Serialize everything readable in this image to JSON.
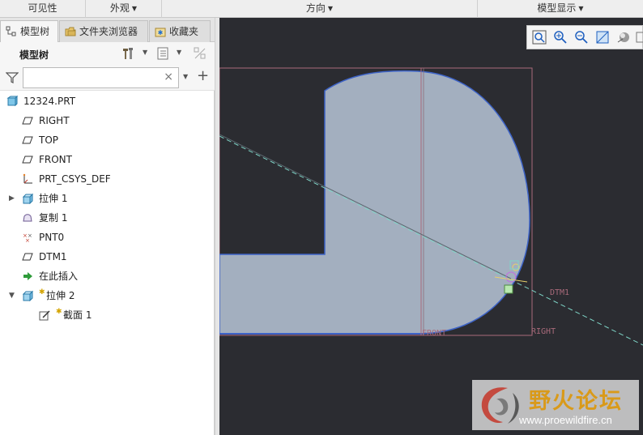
{
  "ribbon": {
    "groups": [
      {
        "label": "可见性",
        "dropdown": false
      },
      {
        "label": "外观",
        "dropdown": true
      },
      {
        "label": "方向",
        "dropdown": true
      },
      {
        "label": "模型显示",
        "dropdown": true
      }
    ]
  },
  "tabs": [
    {
      "label": "模型树",
      "icon": "tree-icon",
      "active": true
    },
    {
      "label": "文件夹浏览器",
      "icon": "folder-icon",
      "active": false
    },
    {
      "label": "收藏夹",
      "icon": "favorites-icon",
      "active": false
    }
  ],
  "tree_header": {
    "title": "模型树"
  },
  "filter": {
    "value": "",
    "placeholder": ""
  },
  "tree": [
    {
      "label": "12324.PRT",
      "icon": "part-icon",
      "indent": 0,
      "expander": ""
    },
    {
      "label": "RIGHT",
      "icon": "datum-plane-icon",
      "indent": 1,
      "expander": ""
    },
    {
      "label": "TOP",
      "icon": "datum-plane-icon",
      "indent": 1,
      "expander": ""
    },
    {
      "label": "FRONT",
      "icon": "datum-plane-icon",
      "indent": 1,
      "expander": ""
    },
    {
      "label": "PRT_CSYS_DEF",
      "icon": "csys-icon",
      "indent": 1,
      "expander": ""
    },
    {
      "label": "拉伸 1",
      "icon": "extrude-icon",
      "indent": 1,
      "expander": "▶"
    },
    {
      "label": "复制 1",
      "icon": "copy-icon",
      "indent": 1,
      "expander": ""
    },
    {
      "label": "PNT0",
      "icon": "datum-point-icon",
      "indent": 1,
      "expander": ""
    },
    {
      "label": "DTM1",
      "icon": "datum-plane-icon",
      "indent": 1,
      "expander": ""
    },
    {
      "label": "在此插入",
      "icon": "insert-arrow-icon",
      "indent": 1,
      "expander": ""
    },
    {
      "label": "拉伸 2",
      "icon": "extrude-icon",
      "indent": 1,
      "expander": "▼"
    },
    {
      "label": "截面 1",
      "icon": "sketch-icon",
      "indent": 2,
      "expander": ""
    }
  ],
  "graphics": {
    "labels": {
      "front": "FRONT",
      "right": "RIGHT",
      "dtm1": "DTM1"
    },
    "colors": {
      "background": "#2b2c31",
      "shape_fill": "#a3afbf",
      "shape_edge": "#3d63c7",
      "datum_line": "#a86a7a",
      "axis_line": "#7fd6c8"
    }
  },
  "watermark": {
    "title": "野火论坛",
    "url": "www.proewildfire.cn"
  }
}
